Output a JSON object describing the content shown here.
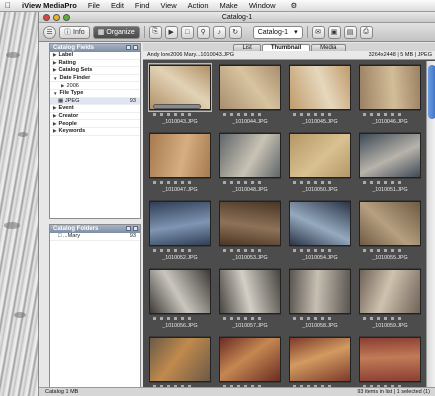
{
  "menubar": {
    "app": "iView MediaPro",
    "items": [
      "File",
      "Edit",
      "Find",
      "View",
      "Action",
      "Make",
      "Window"
    ]
  },
  "window": {
    "title": "Catalog-1"
  },
  "toolbar": {
    "info_label": "Info",
    "organize_label": "Organize",
    "catalog_select": "Catalog-1"
  },
  "catalog_fields": {
    "title": "Catalog Fields",
    "items": [
      {
        "label": "Label",
        "type": "group"
      },
      {
        "label": "Rating",
        "type": "group"
      },
      {
        "label": "Catalog Sets",
        "type": "group"
      },
      {
        "label": "Date Finder",
        "type": "group"
      },
      {
        "label": "2006",
        "type": "sub"
      },
      {
        "label": "File Type",
        "type": "group"
      },
      {
        "label": "JPEG",
        "type": "count",
        "count": "93"
      },
      {
        "label": "Event",
        "type": "group"
      },
      {
        "label": "Creator",
        "type": "group"
      },
      {
        "label": "People",
        "type": "group"
      },
      {
        "label": "Keywords",
        "type": "group"
      }
    ]
  },
  "catalog_folders": {
    "title": "Catalog Folders",
    "items": [
      {
        "label": "...Mary",
        "count": "93"
      }
    ]
  },
  "viewer": {
    "tabs": [
      "List",
      "Thumbnail",
      "Media"
    ],
    "active_tab": "Thumbnail",
    "path": "Andy lore2006 Mary...1010043.JPG",
    "meta": "3264x2448 | 5 MB | JPEG"
  },
  "thumbnails": [
    {
      "name": "_1010043.JPG",
      "c1": "#b29068",
      "c2": "#e2d3b6"
    },
    {
      "name": "_1010044.JPG",
      "c1": "#a98e6e",
      "c2": "#d8c4a0"
    },
    {
      "name": "_1010045.JPG",
      "c1": "#c19b6c",
      "c2": "#e6d8bd"
    },
    {
      "name": "_1010046.JPG",
      "c1": "#9c8164",
      "c2": "#d3bd98"
    },
    {
      "name": "_1010047.JPG",
      "c1": "#a57a4e",
      "c2": "#d6ae82"
    },
    {
      "name": "_1010048.JPG",
      "c1": "#5f6669",
      "c2": "#c9c3b4"
    },
    {
      "name": "_1010050.JPG",
      "c1": "#b59766",
      "c2": "#d9c191"
    },
    {
      "name": "_1010051.JPG",
      "c1": "#3d4a55",
      "c2": "#b8b3ab"
    },
    {
      "name": "_1010052.JPG",
      "c1": "#2f3e55",
      "c2": "#7f95b3"
    },
    {
      "name": "_1010053.JPG",
      "c1": "#4a3626",
      "c2": "#8e7258"
    },
    {
      "name": "_1010054.JPG",
      "c1": "#2b3446",
      "c2": "#95a9bf"
    },
    {
      "name": "_1010055.JPG",
      "c1": "#6f5a44",
      "c2": "#b6a080"
    },
    {
      "name": "_1010056.JPG",
      "c1": "#3d3a36",
      "c2": "#cac6bf"
    },
    {
      "name": "_1010057.JPG",
      "c1": "#484440",
      "c2": "#d3cfc6"
    },
    {
      "name": "_1010058.JPG",
      "c1": "#5a5550",
      "c2": "#c7bfb2"
    },
    {
      "name": "_1010059.JPG",
      "c1": "#6f6258",
      "c2": "#cfc2ae"
    },
    {
      "name": "",
      "c1": "#6b5a47",
      "c2": "#c18a4d"
    },
    {
      "name": "",
      "c1": "#6a2d23",
      "c2": "#c68752"
    },
    {
      "name": "",
      "c1": "#7c3a2a",
      "c2": "#d39b61"
    },
    {
      "name": "",
      "c1": "#8a3f33",
      "c2": "#c27b58"
    }
  ],
  "status": {
    "left": "Catalog  1 MB",
    "right": "93 items in list  |  1 selected (1)"
  }
}
